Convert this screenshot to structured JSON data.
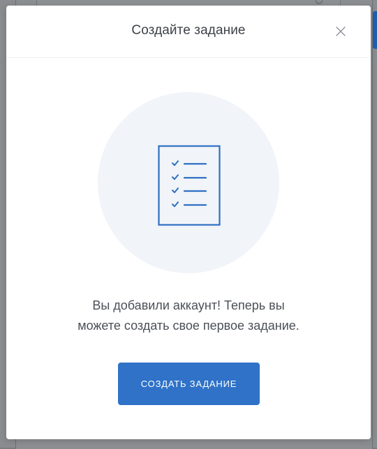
{
  "modal": {
    "title": "Создайте задание",
    "message_line1": "Вы добавили аккаунт! Теперь вы",
    "message_line2": "можете создать свое первое задание.",
    "cta_label": "СОЗДАТЬ ЗАДАНИЕ",
    "close_icon": "close-icon",
    "illustration_icon": "checklist-document-icon"
  },
  "colors": {
    "accent": "#2f72c8",
    "icon_blue": "#2f6fc4",
    "title_text": "#3d4147",
    "body_text": "#4b5057",
    "illustration_bg": "#f1f4f8"
  }
}
